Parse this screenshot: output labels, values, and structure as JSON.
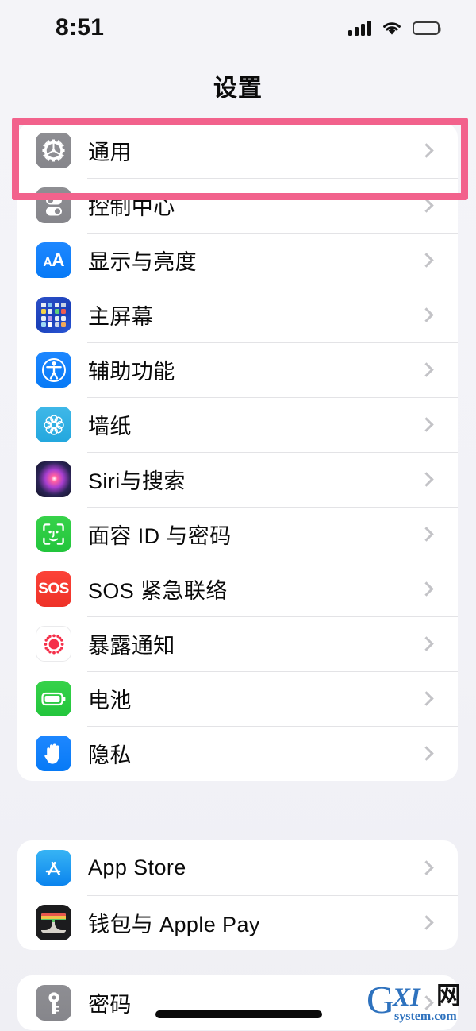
{
  "status_bar": {
    "time": "8:51",
    "cellular_icon": "cellular-signal-icon",
    "cellular_bars": 4,
    "wifi_icon": "wifi-icon",
    "battery_icon": "battery-full-icon"
  },
  "nav": {
    "title": "设置"
  },
  "highlight": {
    "color": "#F2628C",
    "target": "通用"
  },
  "theme": {
    "background": "#EFEFF4",
    "card_background": "#FFFFFF",
    "separator": "#E3E3E6",
    "chevron": "#C3C3C7",
    "label_color": "#0A0A0A"
  },
  "sections": [
    {
      "name": "system-section",
      "rows": [
        {
          "label": "通用",
          "icon": "gear-icon",
          "icon_style": "ic-gray"
        },
        {
          "label": "控制中心",
          "icon": "control-center-icon",
          "icon_style": "ic-gray"
        },
        {
          "label": "显示与亮度",
          "icon": "display-brightness-icon",
          "icon_style": "ic-blue"
        },
        {
          "label": "主屏幕",
          "icon": "home-screen-icon",
          "icon_style": "ic-deepbl"
        },
        {
          "label": "辅助功能",
          "icon": "accessibility-icon",
          "icon_style": "ic-blue"
        },
        {
          "label": "墙纸",
          "icon": "wallpaper-icon",
          "icon_style": "ic-teal"
        },
        {
          "label": "Siri与搜索",
          "icon": "siri-icon",
          "icon_style": "ic-siri"
        },
        {
          "label": "面容 ID 与密码",
          "icon": "face-id-icon",
          "icon_style": "ic-green"
        },
        {
          "label": "SOS 紧急联络",
          "icon": "emergency-sos-icon",
          "icon_style": "ic-red"
        },
        {
          "label": "暴露通知",
          "icon": "exposure-notification-icon",
          "icon_style": "ic-white"
        },
        {
          "label": "电池",
          "icon": "battery-icon",
          "icon_style": "ic-green"
        },
        {
          "label": "隐私",
          "icon": "privacy-hand-icon",
          "icon_style": "ic-blue"
        }
      ]
    },
    {
      "name": "store-section",
      "rows": [
        {
          "label": "App Store",
          "icon": "app-store-icon",
          "icon_style": "ic-appst"
        },
        {
          "label": "钱包与 Apple Pay",
          "icon": "wallet-icon",
          "icon_style": "ic-black"
        }
      ]
    },
    {
      "name": "passwords-section",
      "rows": [
        {
          "label": "密码",
          "icon": "key-icon",
          "icon_style": "ic-gray"
        }
      ]
    }
  ],
  "watermark": {
    "g": "G",
    "xi": "XI",
    "net": "网",
    "domain": "system.com"
  }
}
